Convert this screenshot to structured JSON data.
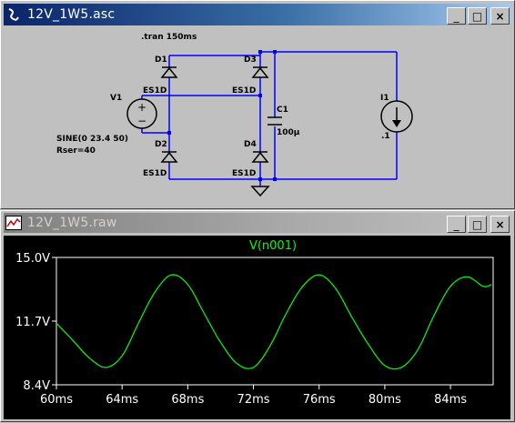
{
  "schematic_window": {
    "title": "12V_1W5.asc",
    "controls": {
      "minimize": "_",
      "maximize": "□",
      "close": "×"
    },
    "directive": ".tran 150ms",
    "components": {
      "d1": {
        "ref": "D1",
        "model": "ES1D"
      },
      "d2": {
        "ref": "D2",
        "model": "ES1D"
      },
      "d3": {
        "ref": "D3",
        "model": "ES1D"
      },
      "d4": {
        "ref": "D4",
        "model": "ES1D"
      },
      "v1": {
        "ref": "V1",
        "value": "SINE(0 23.4 50)",
        "rser": "Rser=40"
      },
      "c1": {
        "ref": "C1",
        "value": "100µ"
      },
      "i1": {
        "ref": "I1",
        "value": ".1"
      }
    },
    "wire_color": "#0000ff"
  },
  "plot_window": {
    "title": "12V_1W5.raw",
    "controls": {
      "minimize": "_",
      "maximize": "□",
      "close": "×"
    },
    "trace_color": "#00ff00"
  },
  "chart_data": {
    "type": "line",
    "title": "V(n001)",
    "series": [
      {
        "name": "V(n001)",
        "x": [
          60,
          61,
          62,
          63,
          64,
          65,
          66,
          67,
          68,
          69,
          70,
          71,
          72,
          73,
          74,
          75,
          76,
          77,
          78,
          79,
          80,
          81,
          82,
          83,
          84,
          85,
          86,
          86.5
        ],
        "y": [
          11.6,
          10.7,
          9.8,
          9.3,
          9.9,
          11.6,
          13.2,
          14.1,
          13.6,
          12.1,
          10.6,
          9.5,
          9.3,
          10.4,
          12.1,
          13.5,
          14.1,
          13.4,
          11.9,
          10.5,
          9.4,
          9.3,
          10.2,
          12.0,
          13.5,
          14.0,
          13.5,
          13.6
        ]
      }
    ],
    "xlim": [
      60,
      86.6
    ],
    "ylim": [
      8.4,
      15.0
    ],
    "x_ticks": [
      "60ms",
      "64ms",
      "68ms",
      "72ms",
      "76ms",
      "80ms",
      "84ms"
    ],
    "y_ticks": [
      "15.0V",
      "11.7V",
      "8.4V"
    ],
    "background": "#000000",
    "axis_color": "#ffffff",
    "grid": false
  }
}
